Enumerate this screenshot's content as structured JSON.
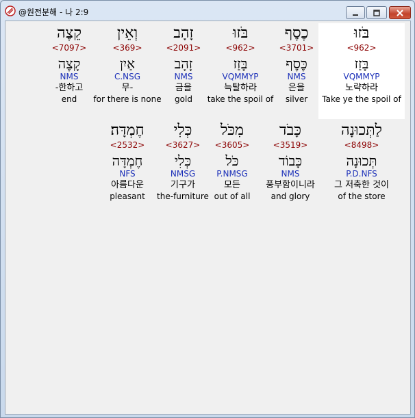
{
  "window": {
    "title": "@원전분해 - 나 2:9",
    "buttons": {
      "minimize": "minimize-icon",
      "maximize": "maximize-icon",
      "close": "close-icon"
    }
  },
  "rows": [
    {
      "cells": [
        {
          "hebrew": "בֹּזוּ",
          "strong": "<962>",
          "lemma": "בָּזַז",
          "morph": "VQMMYP",
          "korean": "노략하라",
          "english": "Take ye the spoil of"
        },
        {
          "hebrew": "כֶסֶף",
          "strong": "<3701>",
          "lemma": "כֶּסֶף",
          "morph": "NMS",
          "korean": "은을",
          "english": "silver"
        },
        {
          "hebrew": "בֹּזוּ",
          "strong": "<962>",
          "lemma": "בָּזַז",
          "morph": "VQMMYP",
          "korean": "늑탈하라",
          "english": "take the spoil of"
        },
        {
          "hebrew": "זָהָב",
          "strong": "<2091>",
          "lemma": "זָהָב",
          "morph": "NMS",
          "korean": "금을",
          "english": "gold"
        },
        {
          "hebrew": "וְאֵין",
          "strong": "<369>",
          "lemma": "אַיִן",
          "morph": "C.NSG",
          "korean": "무-",
          "english": "for there is none"
        },
        {
          "hebrew": "קֵצֶה",
          "strong": "<7097>",
          "lemma": "קָצֶה",
          "morph": "NMS",
          "korean": "-한하고",
          "english": "end"
        }
      ]
    },
    {
      "cells": [
        {
          "hebrew": "לַתְּכוּנָה",
          "strong": "<8498>",
          "lemma": "תְּכוּנָה",
          "morph": "P.D.NFS",
          "korean": "그 저축한 것이",
          "english": "of the store"
        },
        {
          "hebrew": "כָּבֹד",
          "strong": "<3519>",
          "lemma": "כָּבוֹד",
          "morph": "NMS",
          "korean": "풍부함이니라",
          "english": "and glory"
        },
        {
          "hebrew": "מִכֹּל",
          "strong": "<3605>",
          "lemma": "כֹּל",
          "morph": "P.NMSG",
          "korean": "모든",
          "english": "out of all"
        },
        {
          "hebrew": "כְּלִי",
          "strong": "<3627>",
          "lemma": "כְּלִי",
          "morph": "NMSG",
          "korean": "기구가",
          "english": "the-furniture"
        },
        {
          "hebrew": "חֶמְדָּה׃",
          "strong": "<2532>",
          "lemma": "חֶמְדָּה",
          "morph": "NFS",
          "korean": "아름다운",
          "english": "pleasant"
        }
      ]
    }
  ]
}
